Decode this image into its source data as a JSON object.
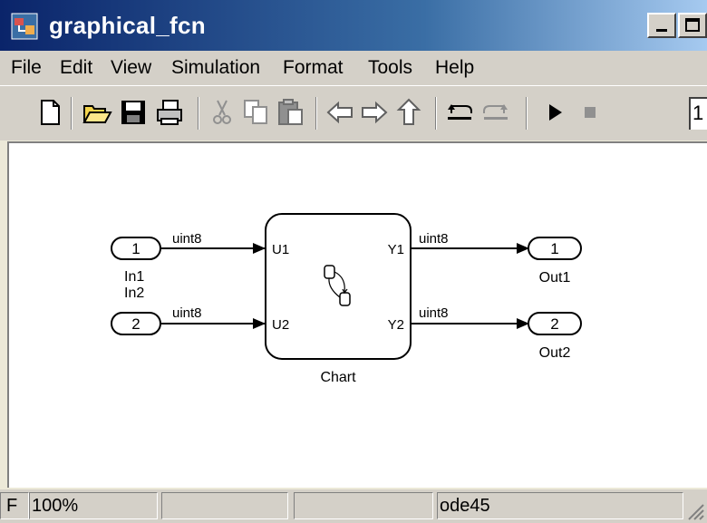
{
  "window": {
    "title": "graphical_fcn"
  },
  "menubar": {
    "items": [
      "File",
      "Edit",
      "View",
      "Simulation",
      "Format",
      "Tools",
      "Help"
    ]
  },
  "toolbar": {
    "stop_time": "1"
  },
  "diagram": {
    "inports": [
      {
        "number": "1",
        "name": "In1"
      },
      {
        "number": "2",
        "name": "In2"
      }
    ],
    "outports": [
      {
        "number": "1",
        "name": "Out1"
      },
      {
        "number": "2",
        "name": "Out2"
      }
    ],
    "input_signals": [
      "uint8",
      "uint8"
    ],
    "output_signals": [
      "uint8",
      "uint8"
    ],
    "chart": {
      "name": "Chart",
      "input_ports": [
        "U1",
        "U2"
      ],
      "output_ports": [
        "Y1",
        "Y2"
      ]
    }
  },
  "statusbar": {
    "cell0": "F",
    "zoom": "100%",
    "cell2": "",
    "cell3": "",
    "solver": "ode45"
  }
}
